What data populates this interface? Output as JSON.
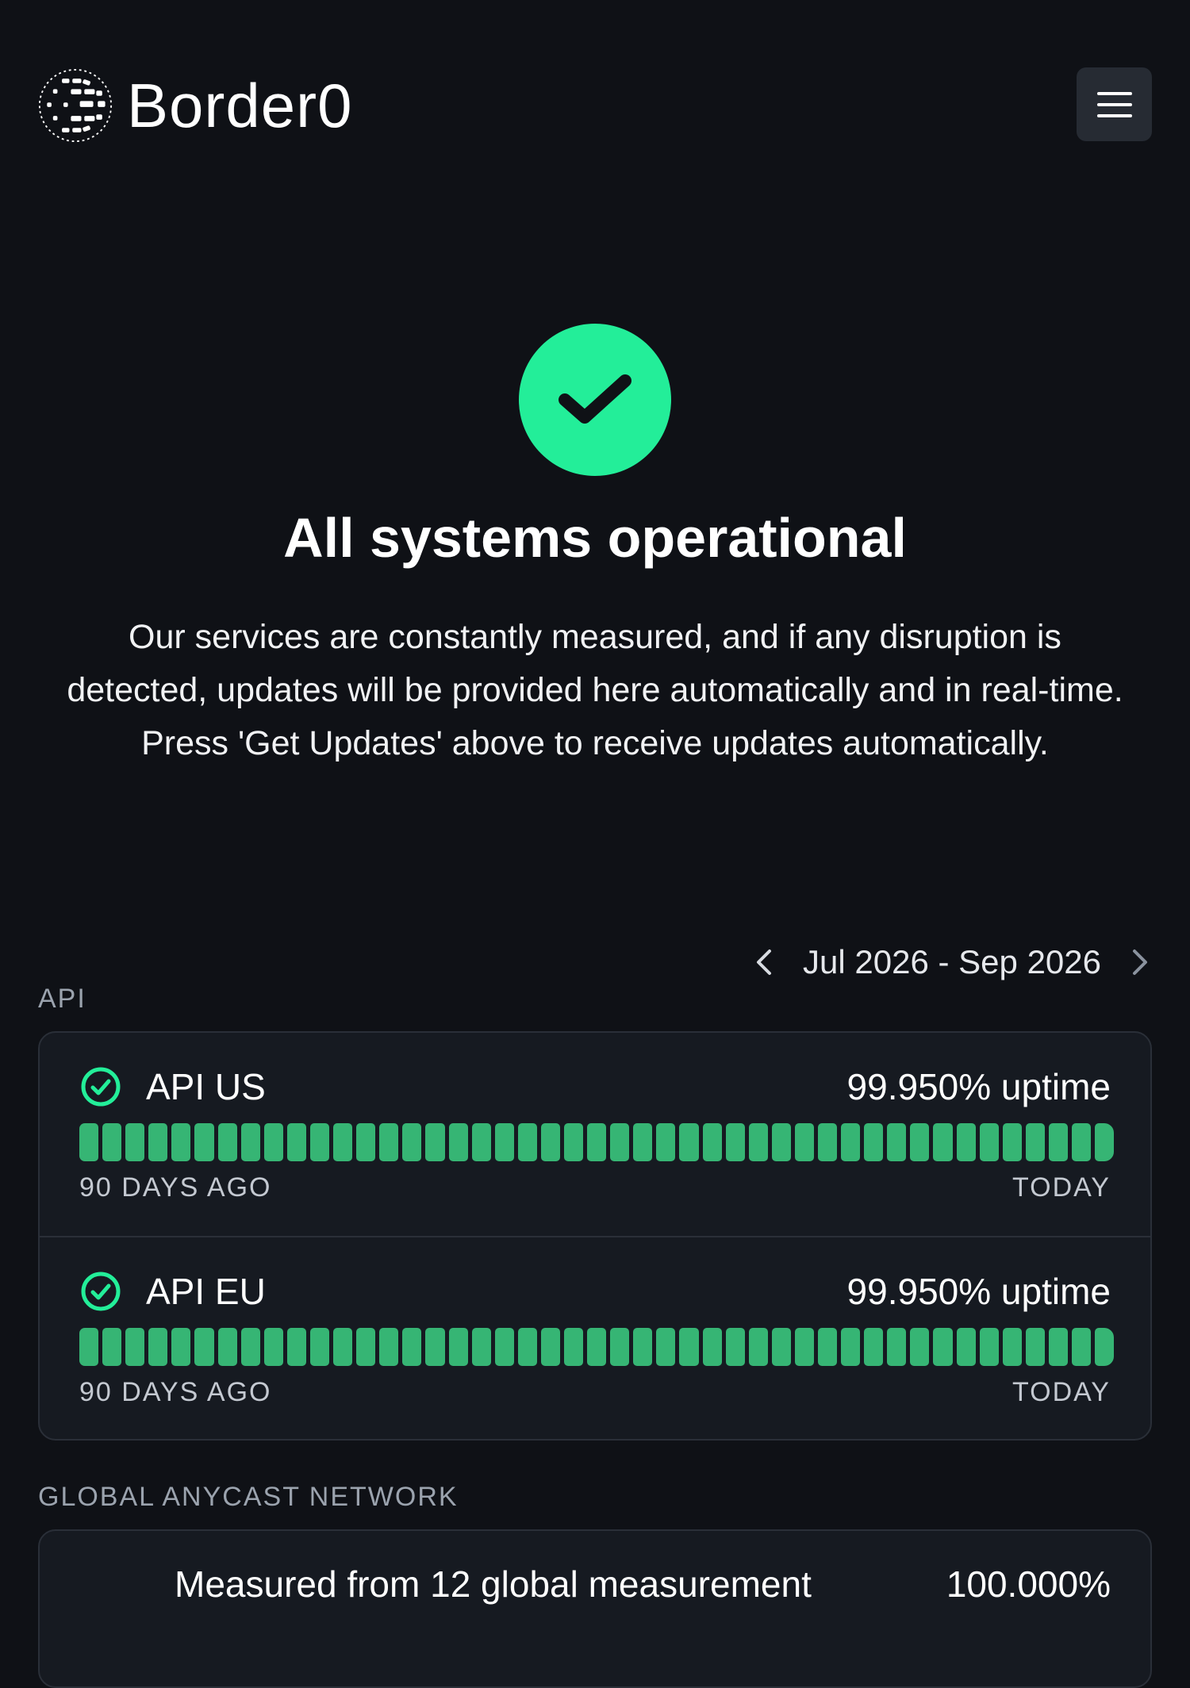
{
  "header": {
    "brand": "Border0"
  },
  "hero": {
    "title": "All systems operational",
    "description_lines": [
      "Our services are constantly measured, and if any disruption is",
      "detected, updates will be provided here automatically and in real-time.",
      "Press 'Get Updates' above to receive updates automatically."
    ]
  },
  "range": {
    "label": "Jul 2026 - Sep 2026"
  },
  "sections": [
    {
      "title": "API",
      "components": [
        {
          "name": "API US",
          "uptime": "99.950% uptime",
          "start_label": "90 DAYS AGO",
          "end_label": "TODAY",
          "bar_count": 45
        },
        {
          "name": "API EU",
          "uptime": "99.950% uptime",
          "start_label": "90 DAYS AGO",
          "end_label": "TODAY",
          "bar_count": 45
        }
      ]
    },
    {
      "title": "GLOBAL ANYCAST NETWORK",
      "rows": [
        {
          "label": "Measured from 12 global measurement",
          "value": "100.000%"
        }
      ]
    }
  ],
  "colors": {
    "background": "#0f1116",
    "accent_green": "#23ee99",
    "bar_green": "#36b574",
    "card_bg": "#161a21",
    "muted_text": "#9ba3ae"
  },
  "icons": {
    "logo": "border0-logo-icon",
    "menu": "hamburger-menu-icon",
    "hero": "checkmark-icon",
    "prev": "chevron-left-icon",
    "next": "chevron-right-icon",
    "status": "check-circle-icon"
  }
}
